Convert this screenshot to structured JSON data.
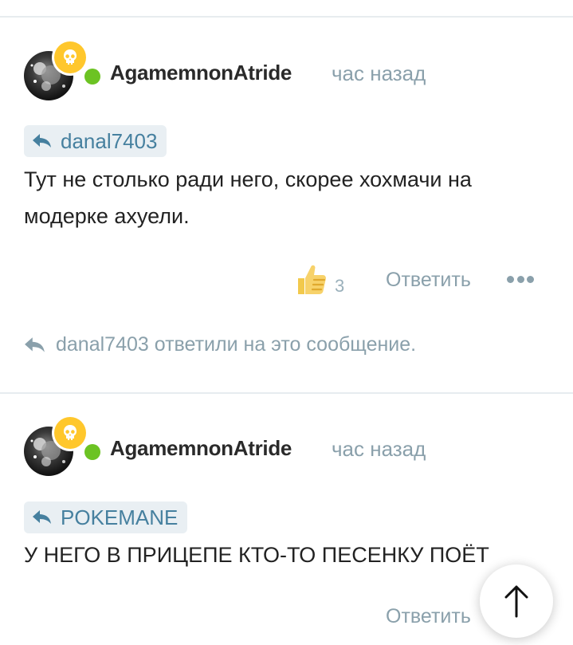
{
  "comments": [
    {
      "username": "AgamemnonAtride",
      "time": "час назад",
      "reply_to": "danal7403",
      "text": "Тут не столько ради него, скорее хохмачи на модерке ахуели.",
      "likes": "3",
      "reply_label": "Ответить",
      "replied_note": "danal7403 ответили на это сообщение."
    },
    {
      "username": "AgamemnonAtride",
      "time": "час назад",
      "reply_to": "POKEMANE",
      "text": "У НЕГО В ПРИЦЕПЕ КТО-ТО ПЕСЕНКУ ПОЁТ",
      "reply_label": "Ответить"
    }
  ],
  "colors": {
    "online": "#6cc323",
    "badge": "#ffc72c",
    "link": "#46809f",
    "muted": "#8aa0ab"
  },
  "icons": {
    "badge": "skull-icon",
    "reply": "reply-arrow-icon",
    "like": "thumbs-up-icon",
    "more": "more-dots-icon",
    "scroll": "arrow-up-icon"
  }
}
